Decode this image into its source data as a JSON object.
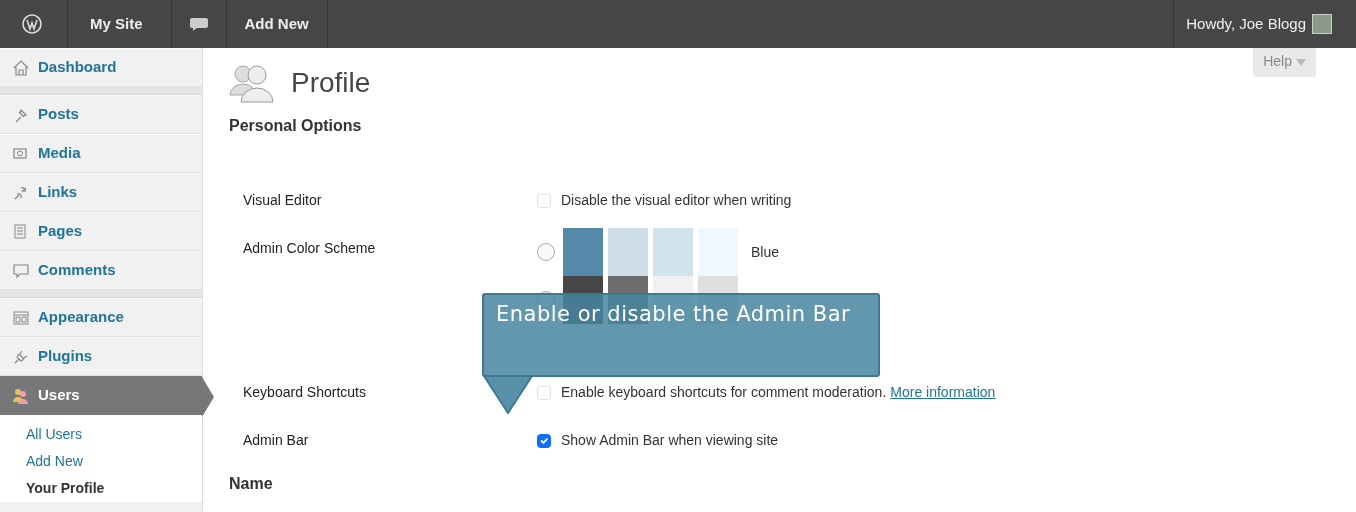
{
  "admin_bar": {
    "items": [
      {
        "kind": "logo"
      },
      {
        "kind": "text",
        "label": "My Site"
      },
      {
        "kind": "comments"
      },
      {
        "kind": "text",
        "label": "Add New"
      }
    ],
    "account": "Howdy, Joe Blogg"
  },
  "sidebar": {
    "items": [
      {
        "label": "Dashboard",
        "selected": false,
        "separator_after": true
      },
      {
        "label": "Posts",
        "selected": false,
        "separator_after": false
      },
      {
        "label": "Media",
        "selected": false,
        "separator_after": false
      },
      {
        "label": "Links",
        "selected": false,
        "separator_after": false
      },
      {
        "label": "Pages",
        "selected": false,
        "separator_after": false
      },
      {
        "label": "Comments",
        "selected": false,
        "separator_after": true
      },
      {
        "label": "Appearance",
        "selected": false,
        "separator_after": false
      },
      {
        "label": "Plugins",
        "selected": false,
        "separator_after": false
      },
      {
        "label": "Users",
        "selected": true,
        "separator_after": false,
        "children": [
          {
            "label": "All Users",
            "selected": false
          },
          {
            "label": "Add New",
            "selected": false
          },
          {
            "label": "Your Profile",
            "selected": true
          }
        ]
      }
    ]
  },
  "help_button": {
    "label": "Help"
  },
  "page": {
    "title": "Profile",
    "sections": [
      {
        "title": "Personal Options",
        "rows": [
          {
            "kind": "checkbox",
            "label": "Visual Editor",
            "text": "Disable the visual editor when writing",
            "checked": false
          },
          {
            "kind": "color_scheme",
            "label": "Admin Color Scheme",
            "options": [
              {
                "name": "Blue",
                "selected": false,
                "swatches": [
                  {
                    "color": "#5589aa"
                  },
                  {
                    "color": "#cfdfe9"
                  },
                  {
                    "color": "#d1e4ee"
                  },
                  {
                    "color": "#eff8ff"
                  }
                ]
              },
              {
                "selected": false,
                "swatches": [
                  {
                    "color": "#464646"
                  },
                  {
                    "color": "#6d6d6d"
                  },
                  {
                    "color": "#f1f1f1"
                  },
                  {
                    "color": "#dfdfdf"
                  }
                ]
              }
            ]
          },
          {
            "kind": "checkbox",
            "label": "Keyboard Shortcuts",
            "text": "Enable keyboard shortcuts for comment moderation.",
            "link": "More information",
            "checked": false
          },
          {
            "kind": "checkbox",
            "label": "Admin Bar",
            "text": "Show Admin Bar when viewing site",
            "checked": true
          }
        ]
      },
      {
        "title": "Name"
      }
    ]
  },
  "tooltip": {
    "text": "Enable or disable the Admin Bar"
  }
}
